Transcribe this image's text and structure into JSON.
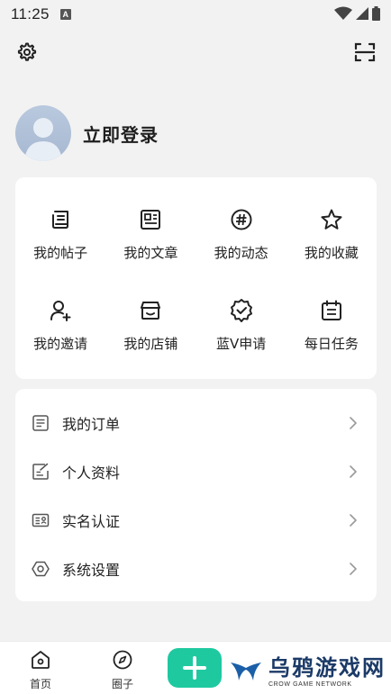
{
  "status_bar": {
    "time": "11:25",
    "notification_badge": "A"
  },
  "profile": {
    "login_label": "立即登录"
  },
  "grid": [
    {
      "label": "我的帖子",
      "icon": "post-icon"
    },
    {
      "label": "我的文章",
      "icon": "article-icon"
    },
    {
      "label": "我的动态",
      "icon": "hashtag-icon"
    },
    {
      "label": "我的收藏",
      "icon": "star-icon"
    },
    {
      "label": "我的邀请",
      "icon": "invite-user-icon"
    },
    {
      "label": "我的店铺",
      "icon": "store-icon"
    },
    {
      "label": "蓝V申请",
      "icon": "verified-badge-icon"
    },
    {
      "label": "每日任务",
      "icon": "calendar-icon"
    }
  ],
  "menu": [
    {
      "label": "我的订单",
      "icon": "order-list-icon"
    },
    {
      "label": "个人资料",
      "icon": "edit-profile-icon"
    },
    {
      "label": "实名认证",
      "icon": "id-card-icon"
    },
    {
      "label": "系统设置",
      "icon": "settings-hex-icon"
    }
  ],
  "bottom_nav": {
    "home_label": "首页",
    "circle_label": "圈子"
  },
  "watermark": {
    "title": "乌鸦游戏网",
    "subtitle": "CROW GAME NETWORK"
  },
  "colors": {
    "accent": "#1fc9a0",
    "background": "#f2f2f2",
    "card": "#ffffff",
    "watermark_blue": "#1b3a67"
  }
}
